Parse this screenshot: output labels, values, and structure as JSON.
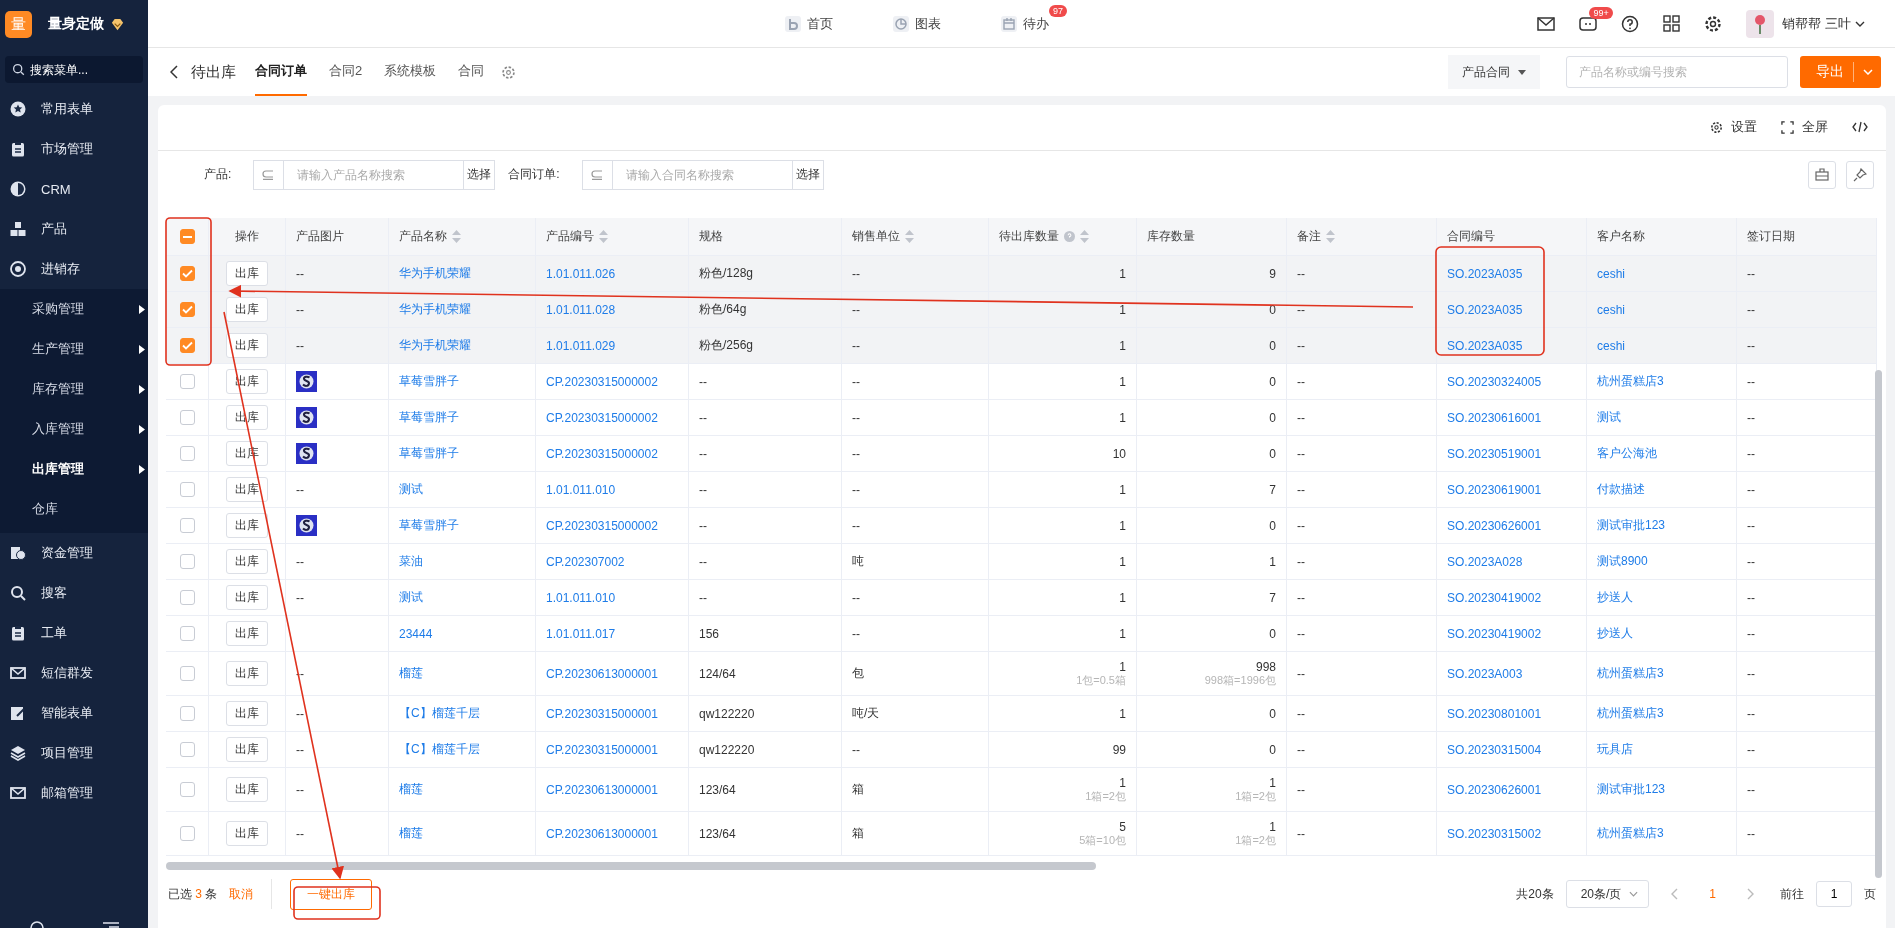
{
  "brand": {
    "logo": "量",
    "name": "量身定做"
  },
  "sidebar": {
    "search_placeholder": "搜索菜单...",
    "items": [
      {
        "label": "常用表单"
      },
      {
        "label": "市场管理"
      },
      {
        "label": "CRM"
      },
      {
        "label": "产品"
      },
      {
        "label": "进销存",
        "children": [
          {
            "label": "采购管理",
            "arrow": true,
            "selected": false
          },
          {
            "label": "生产管理",
            "arrow": true,
            "selected": false
          },
          {
            "label": "库存管理",
            "arrow": true,
            "selected": false
          },
          {
            "label": "入库管理",
            "arrow": true,
            "selected": false
          },
          {
            "label": "出库管理",
            "arrow": true,
            "selected": true
          },
          {
            "label": "仓库",
            "arrow": false,
            "selected": false
          }
        ]
      },
      {
        "label": "资金管理"
      },
      {
        "label": "搜客"
      },
      {
        "label": "工单"
      },
      {
        "label": "短信群发"
      },
      {
        "label": "智能表单"
      },
      {
        "label": "项目管理"
      },
      {
        "label": "邮箱管理"
      }
    ]
  },
  "top_nav": [
    {
      "label": "首页"
    },
    {
      "label": "图表"
    },
    {
      "label": "待办",
      "badge": "97"
    }
  ],
  "top_right": {
    "chat_badge": "99+",
    "user": "销帮帮 三叶"
  },
  "page": {
    "back_title": "待出库",
    "tabs": [
      {
        "label": "合同订单",
        "selected": true
      },
      {
        "label": "合同2",
        "selected": false
      },
      {
        "label": "系统模板",
        "selected": false
      },
      {
        "label": "合同",
        "selected": false
      }
    ],
    "type_select": "产品合同",
    "search_placeholder": "产品名称或编号搜索",
    "export": "导出"
  },
  "toolbar": {
    "settings": "设置",
    "fullscreen": "全屏"
  },
  "filters": [
    {
      "label": "产品:",
      "placeholder": "请输入产品名称搜索",
      "button": "选择"
    },
    {
      "label": "合同订单:",
      "placeholder": "请输入合同名称搜索",
      "button": "选择"
    }
  ],
  "table": {
    "header_indeterminate": true,
    "columns": [
      {
        "label": "操作",
        "sortable": false
      },
      {
        "label": "产品图片",
        "sortable": false
      },
      {
        "label": "产品名称",
        "sortable": true
      },
      {
        "label": "产品编号",
        "sortable": true
      },
      {
        "label": "规格",
        "sortable": false
      },
      {
        "label": "销售单位",
        "sortable": true
      },
      {
        "label": "待出库数量",
        "sortable": true,
        "help": true
      },
      {
        "label": "库存数量",
        "sortable": false
      },
      {
        "label": "备注",
        "sortable": true
      },
      {
        "label": "合同编号",
        "sortable": false
      },
      {
        "label": "客户名称",
        "sortable": false
      },
      {
        "label": "签订日期",
        "sortable": false
      }
    ],
    "rows": [
      {
        "selected": true,
        "action": "出库",
        "has_image": false,
        "picture": "--",
        "name": "华为手机荣耀",
        "code": "1.01.011.026",
        "spec": "粉色/128g",
        "unit": "--",
        "qty": "1",
        "stock": "9",
        "remark": "--",
        "contract": "SO.2023A035",
        "customer": "ceshi",
        "date": "--"
      },
      {
        "selected": true,
        "action": "出库",
        "has_image": false,
        "picture": "--",
        "name": "华为手机荣耀",
        "code": "1.01.011.028",
        "spec": "粉色/64g",
        "unit": "--",
        "qty": "1",
        "stock": "0",
        "remark": "--",
        "contract": "SO.2023A035",
        "customer": "ceshi",
        "date": "--"
      },
      {
        "selected": true,
        "action": "出库",
        "has_image": false,
        "picture": "--",
        "name": "华为手机荣耀",
        "code": "1.01.011.029",
        "spec": "粉色/256g",
        "unit": "--",
        "qty": "1",
        "stock": "0",
        "remark": "--",
        "contract": "SO.2023A035",
        "customer": "ceshi",
        "date": "--"
      },
      {
        "selected": false,
        "action": "出库",
        "has_image": true,
        "name": "草莓雪胖子",
        "code": "CP.20230315000002",
        "spec": "--",
        "unit": "--",
        "qty": "1",
        "stock": "0",
        "remark": "--",
        "contract": "SO.20230324005",
        "customer": "杭州蛋糕店3",
        "date": "--"
      },
      {
        "selected": false,
        "action": "出库",
        "has_image": true,
        "name": "草莓雪胖子",
        "code": "CP.20230315000002",
        "spec": "--",
        "unit": "--",
        "qty": "1",
        "stock": "0",
        "remark": "--",
        "contract": "SO.20230616001",
        "customer": "测试",
        "date": "--"
      },
      {
        "selected": false,
        "action": "出库",
        "has_image": true,
        "name": "草莓雪胖子",
        "code": "CP.20230315000002",
        "spec": "--",
        "unit": "--",
        "qty": "10",
        "stock": "0",
        "remark": "--",
        "contract": "SO.20230519001",
        "customer": "客户公海池",
        "date": "--"
      },
      {
        "selected": false,
        "action": "出库",
        "has_image": false,
        "picture": "--",
        "name": "测试",
        "code": "1.01.011.010",
        "spec": "--",
        "unit": "--",
        "qty": "1",
        "stock": "7",
        "remark": "--",
        "contract": "SO.20230619001",
        "customer": "付款描述",
        "date": "--"
      },
      {
        "selected": false,
        "action": "出库",
        "has_image": true,
        "name": "草莓雪胖子",
        "code": "CP.20230315000002",
        "spec": "--",
        "unit": "--",
        "qty": "1",
        "stock": "0",
        "remark": "--",
        "contract": "SO.20230626001",
        "customer": "测试审批123",
        "date": "--"
      },
      {
        "selected": false,
        "action": "出库",
        "has_image": false,
        "picture": "--",
        "name": "菜油",
        "code": "CP.202307002",
        "spec": "--",
        "unit": "吨",
        "qty": "1",
        "stock": "1",
        "remark": "--",
        "contract": "SO.2023A028",
        "customer": "测试8900",
        "date": "--"
      },
      {
        "selected": false,
        "action": "出库",
        "has_image": false,
        "picture": "--",
        "name": "测试",
        "code": "1.01.011.010",
        "spec": "--",
        "unit": "--",
        "qty": "1",
        "stock": "7",
        "remark": "--",
        "contract": "SO.20230419002",
        "customer": "抄送人",
        "date": "--"
      },
      {
        "selected": false,
        "action": "出库",
        "has_image": false,
        "name": "23444",
        "code": "1.01.011.017",
        "spec": "156",
        "unit": "--",
        "qty": "1",
        "stock": "0",
        "remark": "--",
        "contract": "SO.20230419002",
        "customer": "抄送人",
        "date": "--"
      },
      {
        "selected": false,
        "action": "出库",
        "has_image": false,
        "picture": "--",
        "name": "榴莲",
        "code": "CP.20230613000001",
        "spec": "124/64",
        "unit": "包",
        "qty": "1",
        "qty_note": "1包=0.5箱",
        "stock": "998",
        "stock_note": "998箱=1996包",
        "remark": "--",
        "contract": "SO.2023A003",
        "customer": "杭州蛋糕店3",
        "date": "--"
      },
      {
        "selected": false,
        "action": "出库",
        "has_image": false,
        "picture": "--",
        "name": "【C】榴莲千层",
        "code": "CP.20230315000001",
        "spec": "qw122220",
        "unit": "吨/天",
        "qty": "1",
        "stock": "0",
        "remark": "--",
        "contract": "SO.20230801001",
        "customer": "杭州蛋糕店3",
        "date": "--"
      },
      {
        "selected": false,
        "action": "出库",
        "has_image": false,
        "picture": "--",
        "name": "【C】榴莲千层",
        "code": "CP.20230315000001",
        "spec": "qw122220",
        "unit": "--",
        "qty": "99",
        "stock": "0",
        "remark": "--",
        "contract": "SO.20230315004",
        "customer": "玩具店",
        "date": "--"
      },
      {
        "selected": false,
        "action": "出库",
        "has_image": false,
        "picture": "--",
        "name": "榴莲",
        "code": "CP.20230613000001",
        "spec": "123/64",
        "unit": "箱",
        "qty": "1",
        "qty_note": "1箱=2包",
        "stock": "1",
        "stock_note": "1箱=2包",
        "remark": "--",
        "contract": "SO.20230626001",
        "customer": "测试审批123",
        "date": "--"
      },
      {
        "selected": false,
        "action": "出库",
        "has_image": false,
        "picture": "--",
        "name": "榴莲",
        "code": "CP.20230613000001",
        "spec": "123/64",
        "unit": "箱",
        "qty": "5",
        "qty_note": "5箱=10包",
        "stock": "1",
        "stock_note": "1箱=2包",
        "remark": "--",
        "contract": "SO.20230315002",
        "customer": "杭州蛋糕店3",
        "date": "--"
      }
    ]
  },
  "footer": {
    "selected_prefix": "已选",
    "selected_count": "3",
    "selected_suffix": "条",
    "cancel": "取消",
    "bulk_action": "一键出库",
    "total": "共20条",
    "page_size": "20条/页",
    "current_page": "1",
    "goto_label": "前往",
    "goto_value": "1",
    "goto_suffix": "页"
  }
}
